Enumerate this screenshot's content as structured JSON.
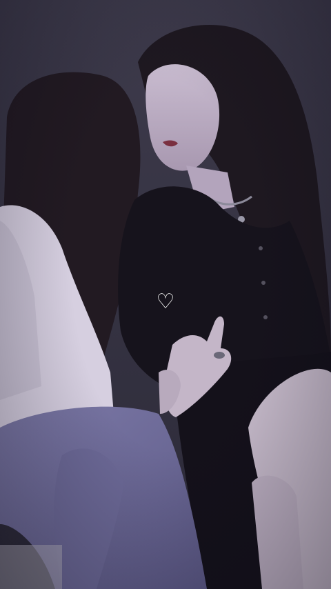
{
  "video": {
    "like_icon": "heart-outline-icon",
    "like_glyph": "♡"
  },
  "colors": {
    "background": "#34323f",
    "tint": "#8a86c8",
    "icon": "#ffffff"
  }
}
